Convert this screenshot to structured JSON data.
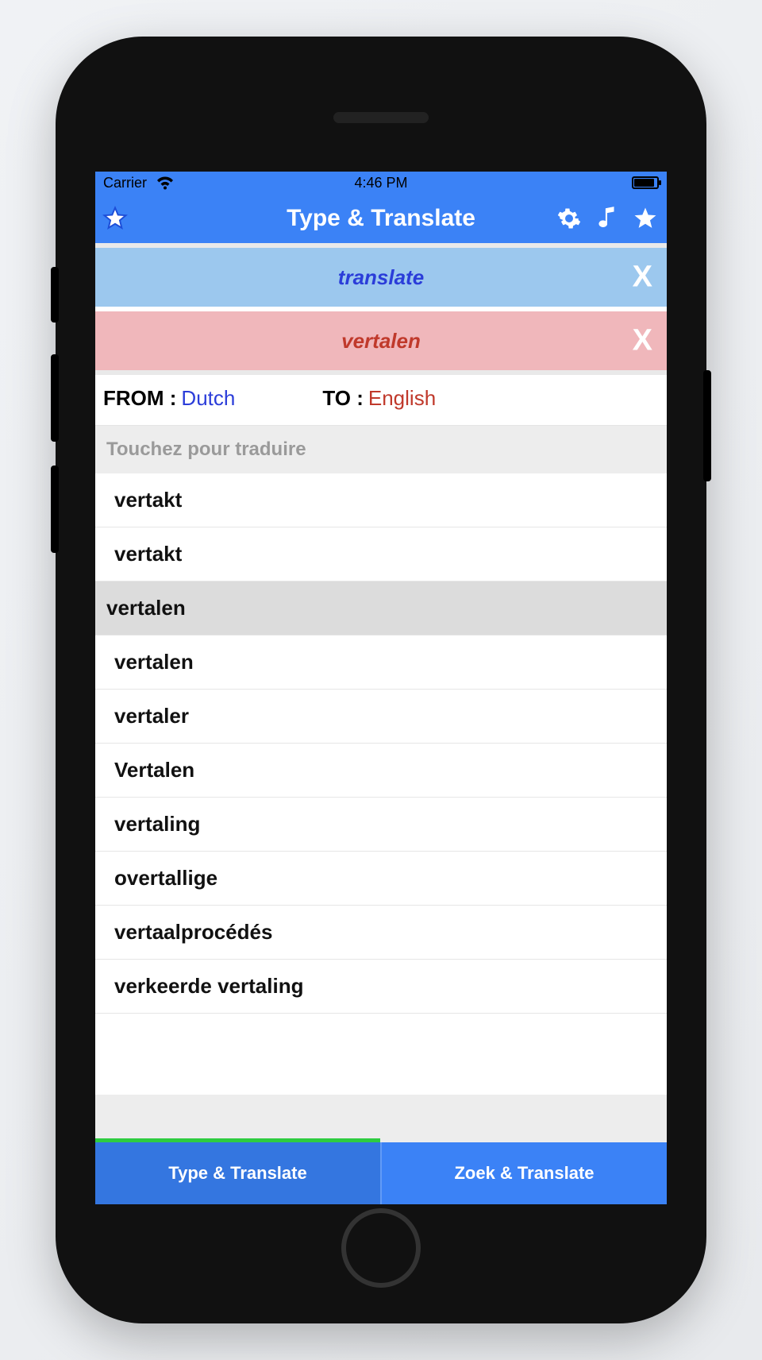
{
  "status": {
    "carrier": "Carrier",
    "time": "4:46 PM"
  },
  "navbar": {
    "title": "Type & Translate"
  },
  "banner_source": {
    "text": "translate",
    "close": "X"
  },
  "banner_target": {
    "text": "vertalen",
    "close": "X"
  },
  "langrow": {
    "from_label": "FROM :",
    "from_value": "Dutch",
    "to_label": "TO :",
    "to_value": "English"
  },
  "hint": "Touchez pour traduire",
  "suggestions": [
    {
      "text": "vertakt",
      "selected": false
    },
    {
      "text": "vertakt",
      "selected": false
    },
    {
      "text": "vertalen",
      "selected": true
    },
    {
      "text": "vertalen",
      "selected": false
    },
    {
      "text": "vertaler",
      "selected": false
    },
    {
      "text": "Vertalen",
      "selected": false
    },
    {
      "text": "vertaling",
      "selected": false
    },
    {
      "text": "overtallige",
      "selected": false
    },
    {
      "text": "vertaalprocédés",
      "selected": false
    },
    {
      "text": "verkeerde vertaling",
      "selected": false
    }
  ],
  "tabs": {
    "left": {
      "label": "Type & Translate",
      "active": true
    },
    "right": {
      "label": "Zoek & Translate",
      "active": false
    }
  }
}
